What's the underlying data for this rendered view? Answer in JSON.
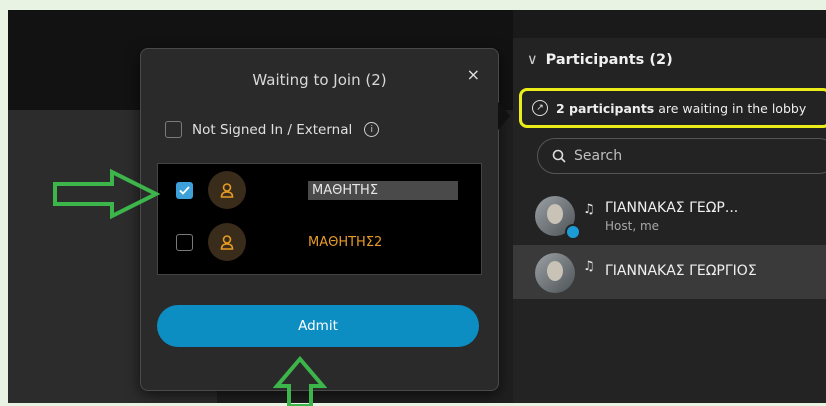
{
  "dialog": {
    "title": "Waiting to Join (2)",
    "close": "×",
    "filter_label": "Not Signed In / External",
    "info": "i",
    "rows": [
      {
        "name": "ΜΑΘΗΤΗΣ",
        "checked": true
      },
      {
        "name": "ΜΑΘΗΤΗΣ2",
        "checked": false
      }
    ],
    "admit_label": "Admit"
  },
  "panel": {
    "header": "Participants (2)",
    "chevron": "∨",
    "lobby_count": "2 participants",
    "lobby_rest": " are waiting in the lobby",
    "search_placeholder": "Search",
    "participants": [
      {
        "name": "ΓΙΑΝΝΑΚΑΣ ΓΕΩΡ...",
        "sub": "Host, me"
      },
      {
        "name": "ΓΙΑΝΝΑΚΑΣ ΓΕΩΡΓΙΟΣ",
        "sub": ""
      }
    ]
  },
  "colors": {
    "accent": "#0d8ec3",
    "highlight": "#ecec1a",
    "annotation_arrow": "#3cb54a",
    "orange_name": "#e79b25"
  }
}
